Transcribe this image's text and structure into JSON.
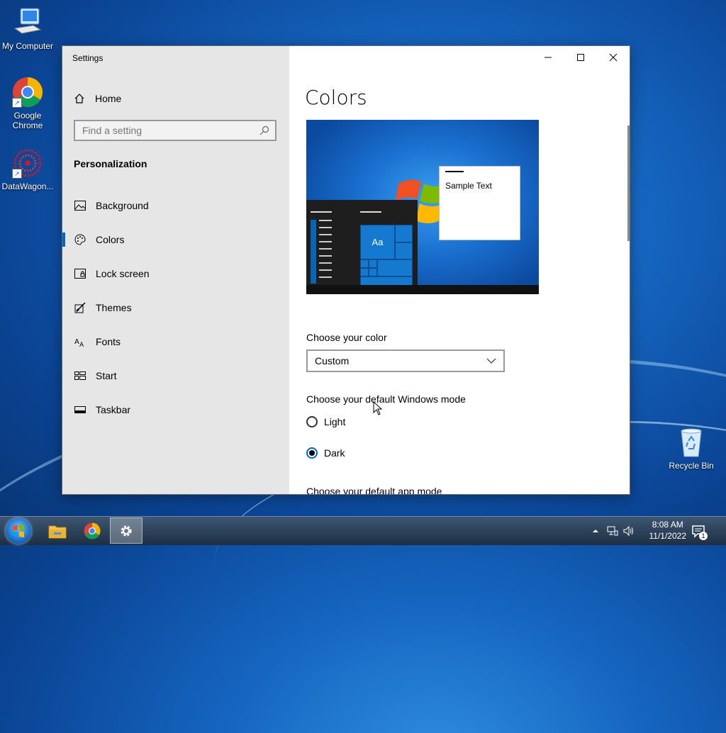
{
  "desktop": {
    "icons": [
      {
        "label": "My Computer"
      },
      {
        "label": "Google Chrome"
      },
      {
        "label": "DataWagon..."
      },
      {
        "label": "Recycle Bin"
      }
    ]
  },
  "window": {
    "title": "Settings",
    "sidebar": {
      "home": "Home",
      "search_placeholder": "Find a setting",
      "section": "Personalization",
      "items": [
        {
          "label": "Background",
          "icon": "picture-icon"
        },
        {
          "label": "Colors",
          "icon": "palette-icon",
          "active": true
        },
        {
          "label": "Lock screen",
          "icon": "lock-screen-icon"
        },
        {
          "label": "Themes",
          "icon": "brush-icon"
        },
        {
          "label": "Fonts",
          "icon": "font-icon"
        },
        {
          "label": "Start",
          "icon": "start-grid-icon"
        },
        {
          "label": "Taskbar",
          "icon": "taskbar-icon"
        }
      ]
    },
    "main": {
      "title": "Colors",
      "preview": {
        "sample_text": "Sample Text",
        "tile_label": "Aa"
      },
      "choose_color_label": "Choose your color",
      "choose_color_value": "Custom",
      "windows_mode_label": "Choose your default Windows mode",
      "windows_mode_options": [
        {
          "label": "Light",
          "selected": false
        },
        {
          "label": "Dark",
          "selected": true
        }
      ],
      "app_mode_label": "Choose your default app mode"
    }
  },
  "taskbar": {
    "time": "8:08 AM",
    "date": "11/1/2022",
    "notification_count": "1"
  },
  "colors": {
    "accent": "#0067c0",
    "sidebar_bg": "#e6e6e6"
  }
}
